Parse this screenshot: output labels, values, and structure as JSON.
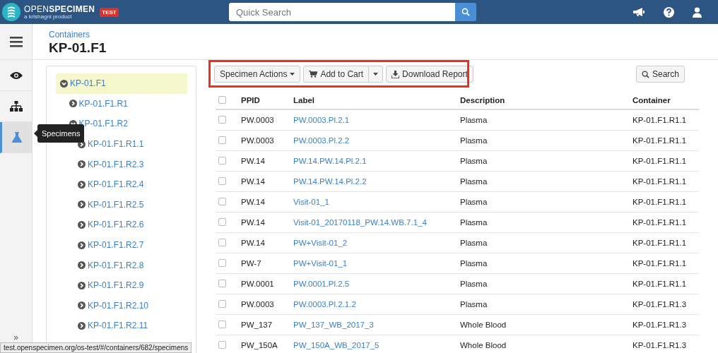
{
  "header": {
    "logo_text": "OPEN**SPECIMEN**",
    "tagline": "a krishagni product",
    "badge": "TEST",
    "search": {
      "placeholder": "Quick Search"
    }
  },
  "rail": {
    "items": [
      {
        "kind": "view",
        "selected": false
      },
      {
        "kind": "hierarchy",
        "selected": false
      },
      {
        "kind": "specimens",
        "selected": true
      }
    ],
    "tooltip": "Specimens",
    "collapse": "»"
  },
  "breadcrumb": "Containers",
  "title": "KP-01.F1",
  "toolbar": {
    "actions": "Specimen Actions",
    "add_to_cart": "Add to Cart",
    "download": "Download Report",
    "search": "Search"
  },
  "tree": [
    {
      "label": "KP-01.F1",
      "expanded": true,
      "selected": true,
      "children": [
        {
          "label": "KP-01.F1.R1",
          "expanded": false,
          "selected": false
        },
        {
          "label": "KP-01.F1.R2",
          "expanded": true,
          "selected": false,
          "children": [
            {
              "label": "KP-01.F1.R1.1",
              "expanded": false,
              "selected": false
            },
            {
              "label": "KP-01.F1.R2.3",
              "expanded": false,
              "selected": false
            },
            {
              "label": "KP-01.F1.R2.4",
              "expanded": false,
              "selected": false
            },
            {
              "label": "KP-01.F1.R2.5",
              "expanded": false,
              "selected": false
            },
            {
              "label": "KP-01.F1.R2.6",
              "expanded": false,
              "selected": false
            },
            {
              "label": "KP-01.F1.R2.7",
              "expanded": false,
              "selected": false
            },
            {
              "label": "KP-01.F1.R2.8",
              "expanded": false,
              "selected": false
            },
            {
              "label": "KP-01.F1.R2.9",
              "expanded": false,
              "selected": false
            },
            {
              "label": "KP-01.F1.R2.10",
              "expanded": false,
              "selected": false
            },
            {
              "label": "KP-01.F1.R2.11",
              "expanded": false,
              "selected": false
            }
          ]
        }
      ]
    }
  ],
  "table": {
    "header_checked": false,
    "columns": [
      "PPID",
      "Label",
      "Description",
      "Container"
    ],
    "rows": [
      {
        "checked": false,
        "ppid": "PW.0003",
        "label": "PW.0003.Pl.2.1",
        "description": "Plasma",
        "container": "KP-01.F1.R1.1"
      },
      {
        "checked": false,
        "ppid": "PW.0003",
        "label": "PW.0003.Pl.2.2",
        "description": "Plasma",
        "container": "KP-01.F1.R1.1"
      },
      {
        "checked": false,
        "ppid": "PW.14",
        "label": "PW.14.PW.14.Pl.2.1",
        "description": "Plasma",
        "container": "KP-01.F1.R1.1"
      },
      {
        "checked": false,
        "ppid": "PW.14",
        "label": "PW.14.PW.14.Pl.2.2",
        "description": "Plasma",
        "container": "KP-01.F1.R1.1"
      },
      {
        "checked": false,
        "ppid": "PW.14",
        "label": "Visit-01_1",
        "description": "Plasma",
        "container": "KP-01.F1.R1.1"
      },
      {
        "checked": false,
        "ppid": "PW.14",
        "label": "Visit-01_20170118_PW.14.WB.7.1_4",
        "description": "Plasma",
        "container": "KP-01.F1.R1.1"
      },
      {
        "checked": false,
        "ppid": "PW.14",
        "label": "PW+Visit-01_2",
        "description": "Plasma",
        "container": "KP-01.F1.R1.1"
      },
      {
        "checked": false,
        "ppid": "PW-7",
        "label": "PW+Visit-01_1",
        "description": "Plasma",
        "container": "KP-01.F1.R1.1"
      },
      {
        "checked": false,
        "ppid": "PW.0001",
        "label": "PW.0001.Pl.2.5",
        "description": "Plasma",
        "container": "KP-01.F1.R1.1"
      },
      {
        "checked": false,
        "ppid": "PW.0003",
        "label": "PW.0003.Pl.2.1.2",
        "description": "Plasma",
        "container": "KP-01.F1.R1.3"
      },
      {
        "checked": false,
        "ppid": "PW_137",
        "label": "PW_137_WB_2017_3",
        "description": "Whole Blood",
        "container": "KP-01.F1.R1.3"
      },
      {
        "checked": false,
        "ppid": "PW_150A",
        "label": "PW_150A_WB_2017_5",
        "description": "Whole Blood",
        "container": "KP-01.F1.R1.3"
      }
    ]
  },
  "status_bar": {
    "url": "test.openspecimen.org/os-test/#/containers/682/specimens"
  }
}
